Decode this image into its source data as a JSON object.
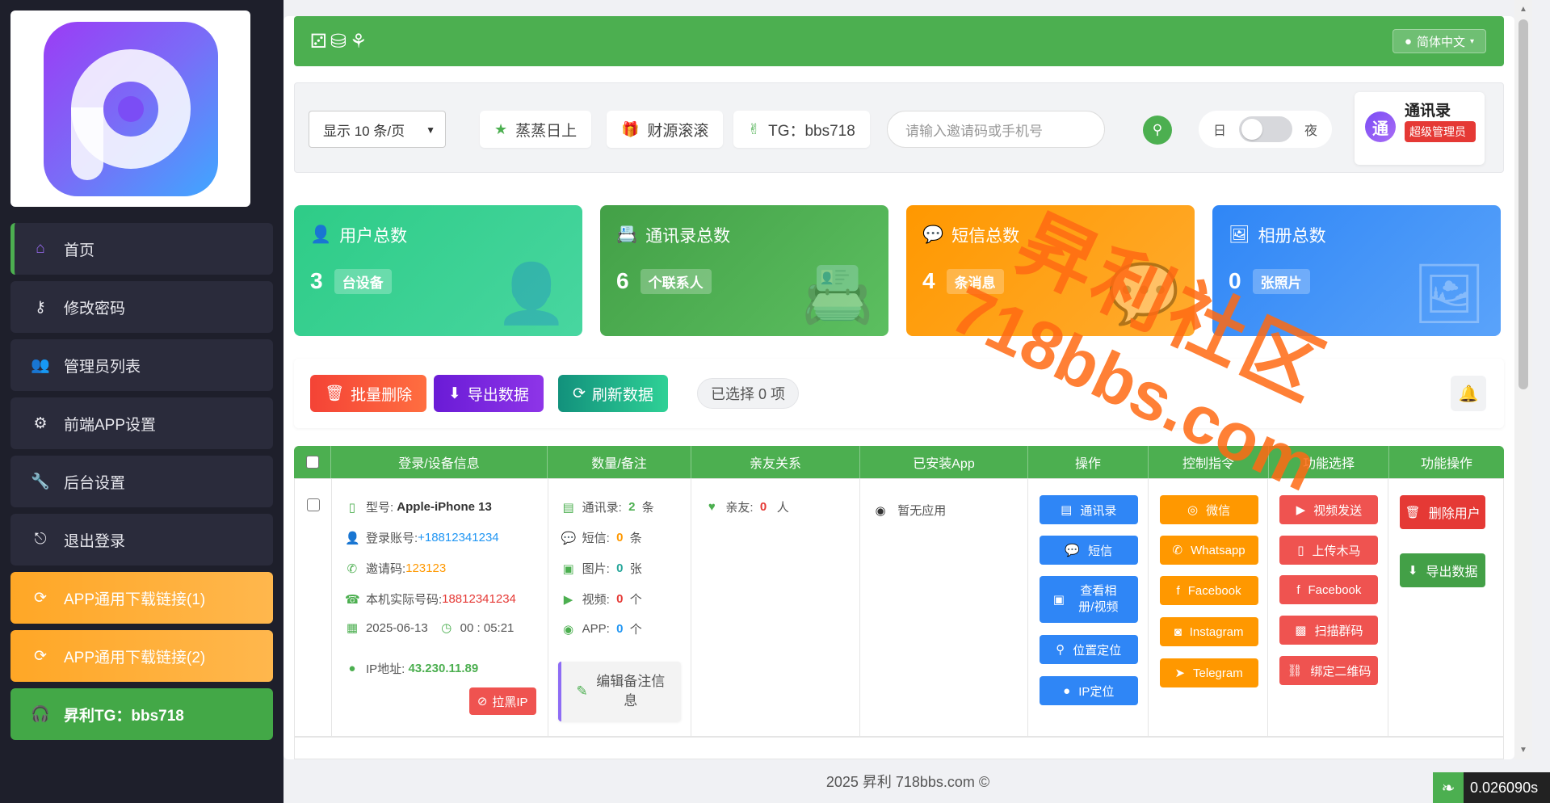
{
  "sidebar": {
    "items": [
      {
        "label": "首页",
        "icon": "home-icon",
        "glyph": "⌂"
      },
      {
        "label": "修改密码",
        "icon": "key-icon",
        "glyph": "⚷"
      },
      {
        "label": "管理员列表",
        "icon": "users-icon",
        "glyph": "👥"
      },
      {
        "label": "前端APP设置",
        "icon": "gear-icon",
        "glyph": "⚙"
      },
      {
        "label": "后台设置",
        "icon": "wrench-icon",
        "glyph": "🔧"
      },
      {
        "label": "退出登录",
        "icon": "logout-icon",
        "glyph": "⎋"
      }
    ],
    "download1": "APP通用下载链接(1)",
    "download2": "APP通用下载链接(2)",
    "tg": "昇利TG：bbs718"
  },
  "topbar": {
    "language": "简体中文"
  },
  "toolbar": {
    "page_size": "显示 10 条/页",
    "tag1": "蒸蒸日上",
    "tag2": "财源滚滚",
    "tag3": "TG：bbs718",
    "search_placeholder": "请输入邀请码或手机号",
    "theme_day": "日",
    "theme_night": "夜"
  },
  "profile": {
    "avatar_text": "通",
    "name": "通讯录",
    "role": "超级管理员"
  },
  "stats": [
    {
      "title": "用户总数",
      "value": "3",
      "unit": "台设备",
      "color": "#3ecf8e"
    },
    {
      "title": "通讯录总数",
      "value": "6",
      "unit": "个联系人",
      "color": "#4caf50"
    },
    {
      "title": "短信总数",
      "value": "4",
      "unit": "条消息",
      "color": "#ffa000"
    },
    {
      "title": "相册总数",
      "value": "0",
      "unit": "张照片",
      "color": "#3d8ef8"
    }
  ],
  "actions": {
    "batch_delete": "批量删除",
    "export": "导出数据",
    "refresh": "刷新数据",
    "selected": "已选择 0 项"
  },
  "table": {
    "headers": [
      "登录/设备信息",
      "数量/备注",
      "亲友关系",
      "已安装App",
      "操作",
      "控制指令",
      "功能选择",
      "功能操作"
    ],
    "row": {
      "model_label": "型号:",
      "model": "Apple-iPhone 13",
      "account_label": "登录账号:",
      "account": "+18812341234",
      "invite_label": "邀请码:",
      "invite": "123123",
      "phone_label": "本机实际号码:",
      "phone": "18812341234",
      "date": "2025-06-13",
      "time": "00 : 05:21",
      "ip_label": "IP地址:",
      "ip": "43.230.11.89",
      "blacklist": "拉黑IP",
      "contacts_label": "通讯录:",
      "contacts": "2",
      "contacts_unit": "条",
      "sms_label": "短信:",
      "sms": "0",
      "sms_unit": "条",
      "photos_label": "图片:",
      "photos": "0",
      "photos_unit": "张",
      "video_label": "视频:",
      "video": "0",
      "video_unit": "个",
      "app_label": "APP:",
      "app": "0",
      "app_unit": "个",
      "edit_note": "编辑备注信息",
      "friends_label": "亲友:",
      "friends": "0",
      "friends_unit": "人",
      "installed": "暂无应用",
      "ops": [
        "通讯录",
        "短信",
        "查看相册/视频",
        "位置定位",
        "IP定位"
      ],
      "controls": [
        "微信",
        "Whatsapp",
        "Facebook",
        "Instagram",
        "Telegram"
      ],
      "features": [
        "视频发送",
        "上传木马",
        "Facebook",
        "扫描群码",
        "绑定二维码"
      ],
      "func_ops": [
        "删除用户",
        "导出数据"
      ]
    }
  },
  "footer": {
    "text": "2025 昇利 718bbs.com ©",
    "timer": "0.026090s"
  },
  "watermark": {
    "line1": "昇利社区",
    "line2": "718bbs.com"
  }
}
